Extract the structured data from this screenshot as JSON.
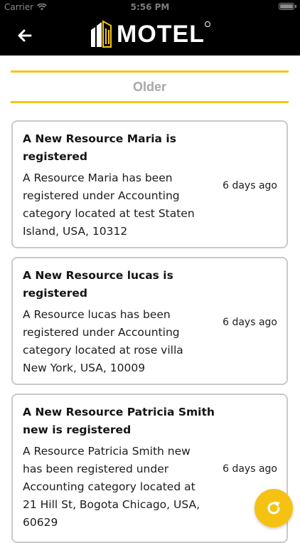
{
  "status_bar": {
    "carrier": "Carrier",
    "time": "5:56 PM"
  },
  "header": {
    "back_icon": "back-arrow-icon",
    "logo_text": "MOTEL",
    "logo_icon": "building-logo-icon",
    "background": "#000000"
  },
  "section": {
    "title": "Older",
    "accent": "#F5C614"
  },
  "notifications": [
    {
      "title": "A New Resource Maria is registered",
      "body": "A Resource Maria has been registered under Accounting category located at test Staten Island, USA, 10312",
      "time": "6 days ago"
    },
    {
      "title": "A New Resource lucas is registered",
      "body": "A Resource lucas has been registered under Accounting category located at rose villa New York, USA, 10009",
      "time": "6 days ago"
    },
    {
      "title": "A New Resource Patricia Smith new is registered",
      "body": "A Resource Patricia Smith new has been registered under Accounting category located at 21 Hill St, Bogota Chicago, USA, 60629",
      "time": "6 days ago"
    }
  ],
  "fab": {
    "icon": "refresh-icon",
    "color": "#F5C214"
  }
}
